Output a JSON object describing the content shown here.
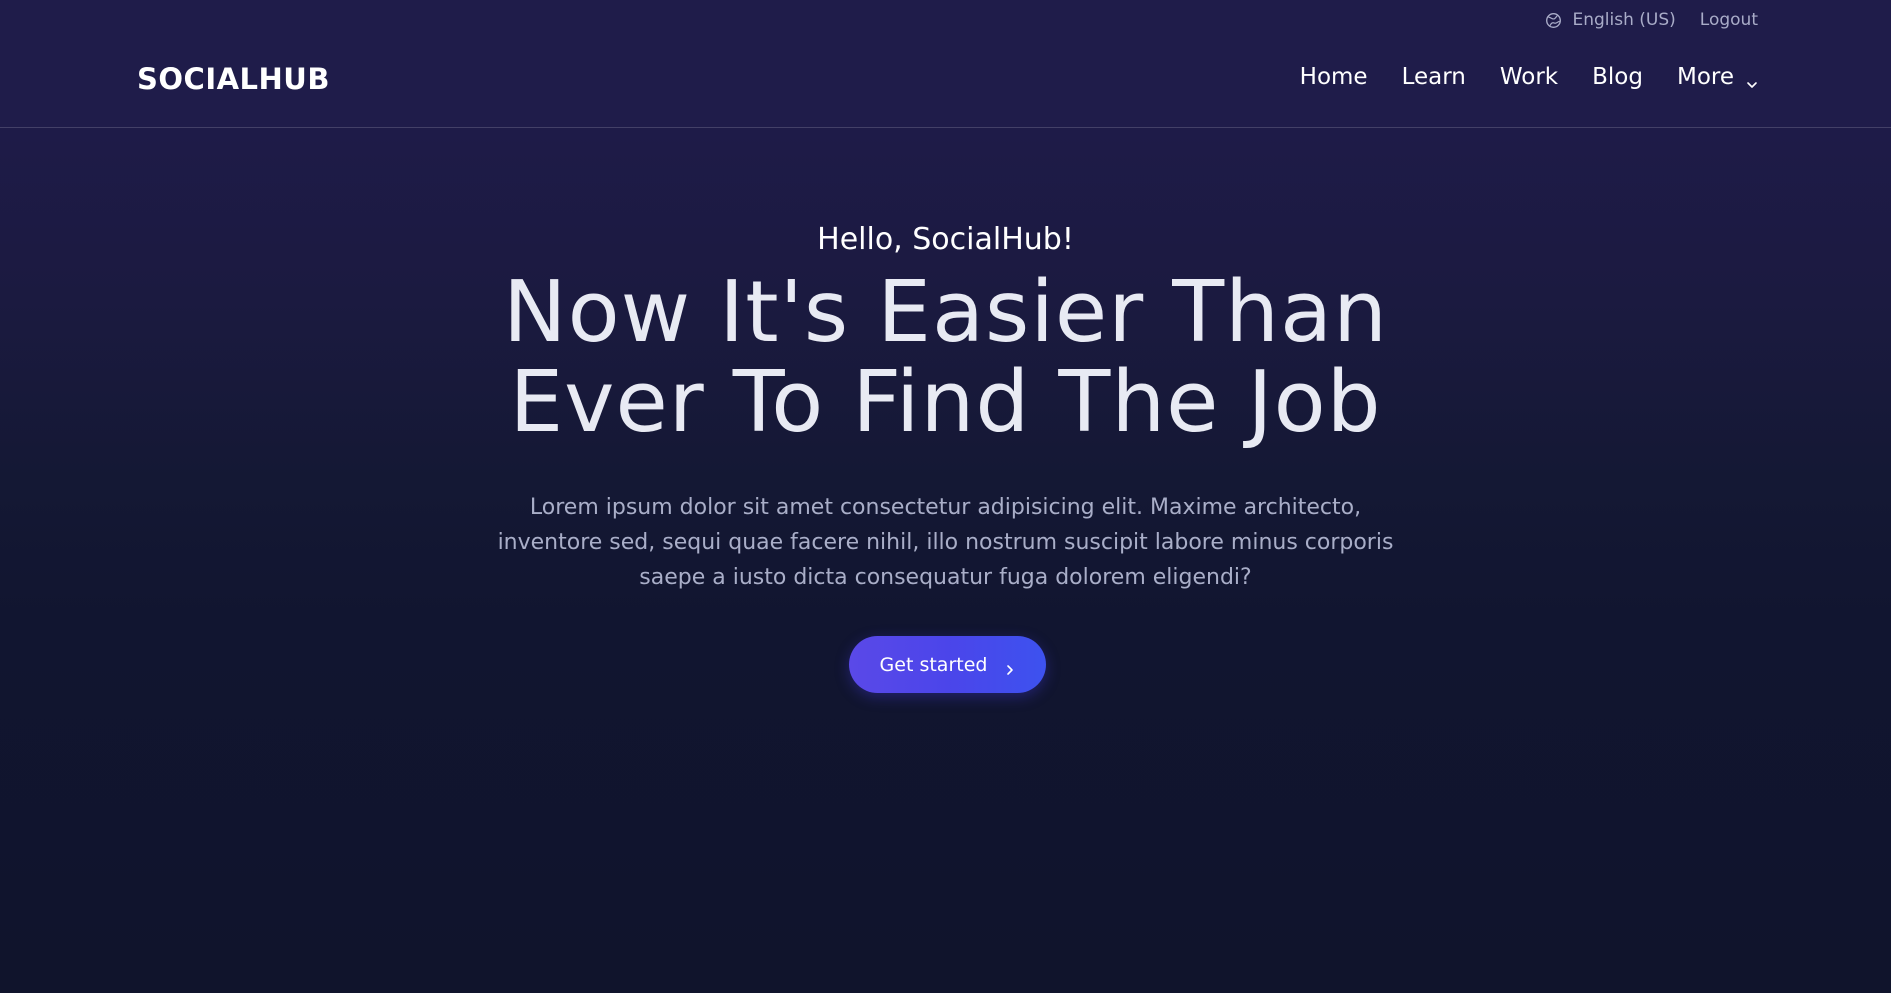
{
  "header": {
    "brand": "SOCIALHUB",
    "utility": {
      "language_label": "English (US)",
      "language_icon": "globe-icon",
      "logout_label": "Logout"
    },
    "nav": {
      "items": [
        {
          "label": "Home"
        },
        {
          "label": "Learn"
        },
        {
          "label": "Work"
        },
        {
          "label": "Blog"
        },
        {
          "label": "More",
          "icon": "chevron-down-icon"
        }
      ]
    }
  },
  "hero": {
    "greeting": "Hello, SocialHub!",
    "headline_line1": "Now It's Easier Than",
    "headline_line2": "Ever To Find The Job",
    "subtext": "Lorem ipsum dolor sit amet consectetur adipisicing elit. Maxime architecto, inventore sed, sequi quae facere nihil, illo nostrum suscipit labore minus corporis saepe a iusto dicta consequatur fuga dolorem eligendi?",
    "cta_label": "Get started",
    "cta_icon": "chevron-right-icon"
  },
  "colors": {
    "background_top": "#1f1c4a",
    "background_bottom": "#10142c",
    "cta_gradient_start": "#5a49e8",
    "cta_gradient_end": "#3d52ef",
    "muted_text": "#a9aec8"
  }
}
